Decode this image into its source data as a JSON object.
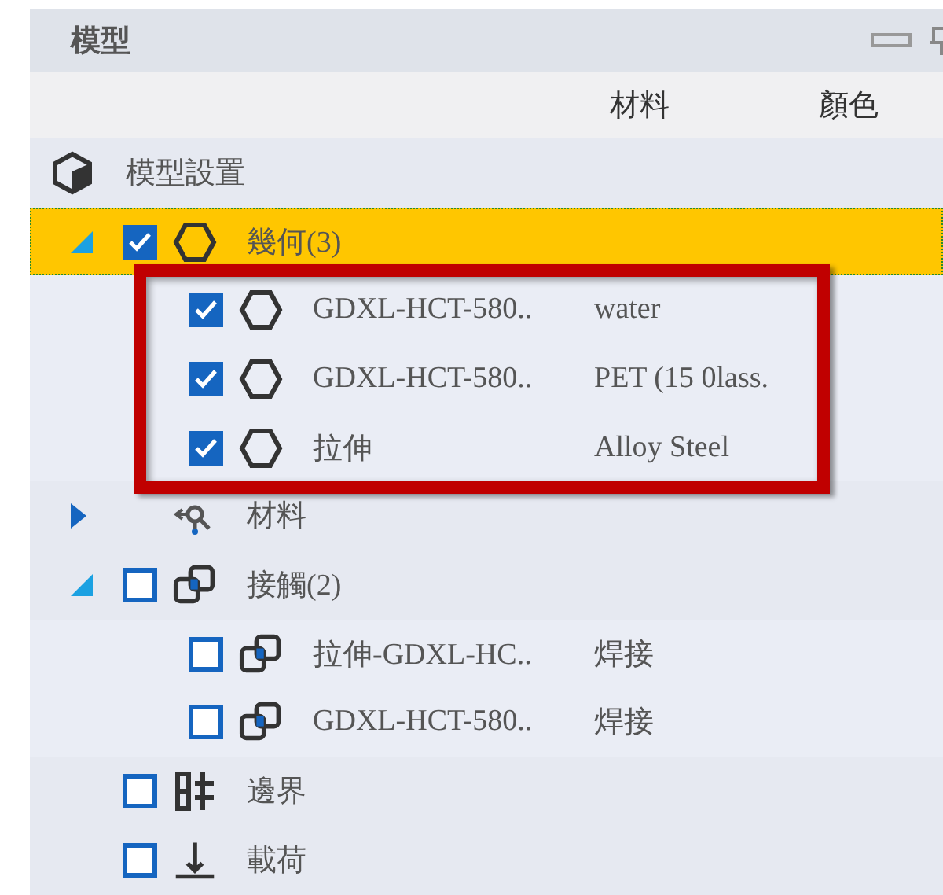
{
  "panel": {
    "title": "模型"
  },
  "columns": [
    "材料",
    "顏色"
  ],
  "tree": [
    {
      "label": "模型設置",
      "kind": "model",
      "selected": false,
      "children": [
        {
          "label": "幾何(3)",
          "kind": "body",
          "selected": true,
          "expanded": true,
          "checked": true,
          "children": [
            {
              "label": "GDXL-HCT-580..",
              "material": "water",
              "kind": "body",
              "selected": false,
              "checked": true
            },
            {
              "label": "GDXL-HCT-580..",
              "material": "PET (15 0lass.",
              "kind": "body",
              "selected": false,
              "checked": true
            },
            {
              "label": "拉伸",
              "material": "Alloy Steel",
              "kind": "body",
              "selected": false,
              "checked": true
            }
          ]
        },
        {
          "label": "材料",
          "kind": "material",
          "selected": false,
          "expanded": false
        },
        {
          "label": "接觸(2)",
          "kind": "contact",
          "selected": false,
          "expanded": true,
          "checked": false,
          "children": [
            {
              "label": "拉伸-GDXL-HC..",
              "material": "焊接",
              "kind": "contact",
              "selected": false,
              "checked": false
            },
            {
              "label": "GDXL-HCT-580..",
              "material": "焊接",
              "kind": "contact",
              "selected": false,
              "checked": false
            }
          ]
        },
        {
          "label": "邊界",
          "kind": "boundary",
          "selected": false,
          "checked": false
        },
        {
          "label": "載荷",
          "kind": "load",
          "selected": false,
          "checked": false
        }
      ]
    }
  ],
  "annotation": {
    "kind": "highlight-frame"
  }
}
